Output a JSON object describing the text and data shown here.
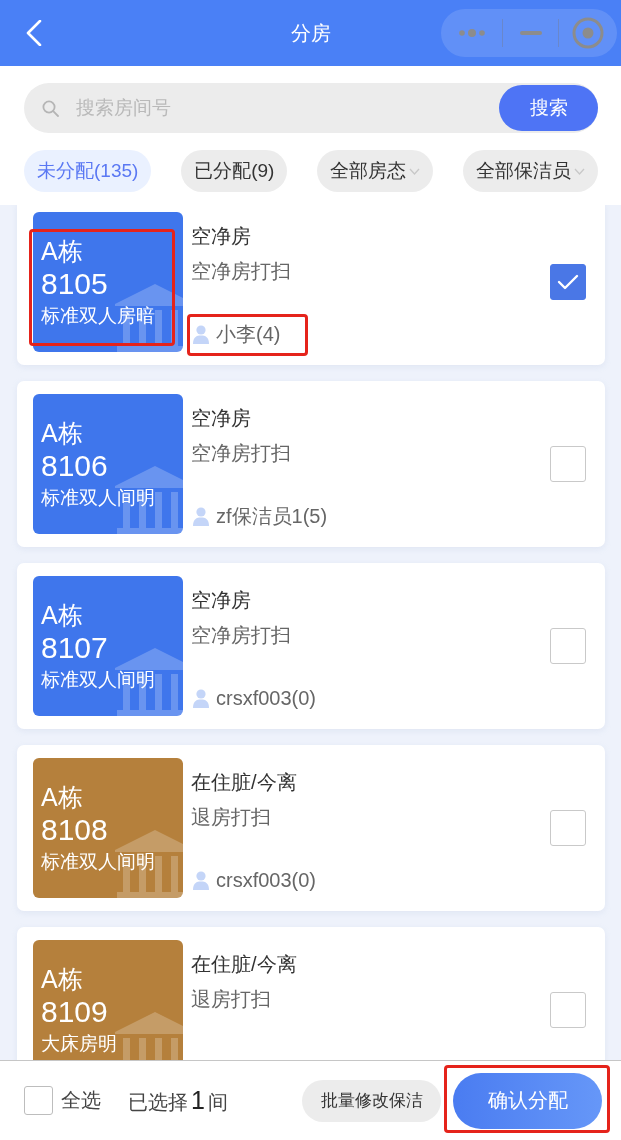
{
  "header": {
    "title": "分房"
  },
  "search": {
    "placeholder": "搜索房间号",
    "button": "搜索"
  },
  "filters": [
    {
      "kind": "tab",
      "label": "未分配(135)",
      "selected": true
    },
    {
      "kind": "tab",
      "label": "已分配(9)",
      "selected": false
    },
    {
      "kind": "dropdown",
      "label": "全部房态",
      "selected": false
    },
    {
      "kind": "dropdown",
      "label": "全部保洁员",
      "selected": false
    }
  ],
  "rooms": [
    {
      "building": "A栋",
      "number": "8105",
      "type": "标准双人房暗",
      "color": "#3f76ec",
      "status": "空净房",
      "task": "空净房打扫",
      "cleaner": "小李(4)",
      "checked": true,
      "highlighted": true
    },
    {
      "building": "A栋",
      "number": "8106",
      "type": "标准双人间明",
      "color": "#3f76ec",
      "status": "空净房",
      "task": "空净房打扫",
      "cleaner": "zf保洁员1(5)",
      "checked": false,
      "highlighted": false
    },
    {
      "building": "A栋",
      "number": "8107",
      "type": "标准双人间明",
      "color": "#3f76ec",
      "status": "空净房",
      "task": "空净房打扫",
      "cleaner": "crsxf003(0)",
      "checked": false,
      "highlighted": false
    },
    {
      "building": "A栋",
      "number": "8108",
      "type": "标准双人间明",
      "color": "#b5803c",
      "status": "在住脏/今离",
      "task": "退房打扫",
      "cleaner": "crsxf003(0)",
      "checked": false,
      "highlighted": false
    },
    {
      "building": "A栋",
      "number": "8109",
      "type": "大床房明",
      "color": "#b5803c",
      "status": "在住脏/今离",
      "task": "退房打扫",
      "checked": false,
      "highlighted": false
    }
  ],
  "footer": {
    "select_all": {
      "label": "全选",
      "checked": false
    },
    "selection": {
      "prefix": "已选择",
      "count": "1",
      "suffix": "间"
    },
    "batch_button": "批量修改保洁",
    "confirm_button": {
      "label": "确认分配",
      "highlighted": true
    }
  }
}
